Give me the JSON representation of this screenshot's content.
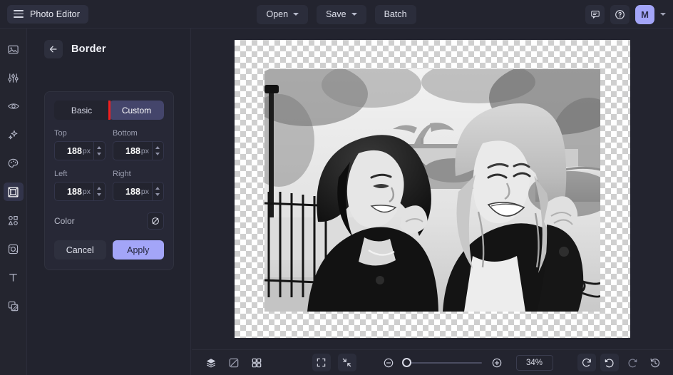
{
  "app": {
    "brand_title": "Photo Editor",
    "menu_icon": "hamburger-icon"
  },
  "topbar": {
    "open_label": "Open",
    "save_label": "Save",
    "batch_label": "Batch",
    "feedback_icon": "comment-icon",
    "help_icon": "question-circle-icon",
    "avatar_initial": "M",
    "avatar_color": "#a3a5f8"
  },
  "rail": {
    "items": [
      {
        "name": "image-icon",
        "label": "Image",
        "active": false
      },
      {
        "name": "adjustments-icon",
        "label": "Adjust",
        "active": false
      },
      {
        "name": "eye-icon",
        "label": "Retouch",
        "active": false
      },
      {
        "name": "sparkles-icon",
        "label": "Effects",
        "active": false
      },
      {
        "name": "palette-icon",
        "label": "Filters",
        "active": false
      },
      {
        "name": "border-icon",
        "label": "Border",
        "active": true
      },
      {
        "name": "shapes-icon",
        "label": "Shapes",
        "active": false
      },
      {
        "name": "frame-icon",
        "label": "Frames",
        "active": false
      },
      {
        "name": "text-icon",
        "label": "Text",
        "active": false
      },
      {
        "name": "layers-overlay-icon",
        "label": "Overlay",
        "active": false
      }
    ]
  },
  "panel": {
    "back_icon": "arrow-left-icon",
    "title": "Border",
    "tabs": [
      {
        "label": "Basic",
        "active": false
      },
      {
        "label": "Custom",
        "active": true
      }
    ],
    "highlight_color": "#f01f1f",
    "fields": [
      {
        "label": "Top",
        "value": "188",
        "unit": "px"
      },
      {
        "label": "Bottom",
        "value": "188",
        "unit": "px"
      },
      {
        "label": "Left",
        "value": "188",
        "unit": "px"
      },
      {
        "label": "Right",
        "value": "188",
        "unit": "px"
      }
    ],
    "color_label": "Color",
    "color_swatch_icon": "no-color-slashed-circle-icon",
    "cancel_label": "Cancel",
    "apply_label": "Apply"
  },
  "canvas": {
    "background": "transparent-checkerboard",
    "photo_alt": "Black and white photo of two women laughing outdoors in a park"
  },
  "bottombar": {
    "left_tools": [
      {
        "name": "layers-icon"
      },
      {
        "name": "transparency-icon"
      },
      {
        "name": "grid-icon"
      }
    ],
    "fit_tools": [
      {
        "name": "fit-screen-icon"
      },
      {
        "name": "shrink-to-fit-icon"
      }
    ],
    "zoom_out_icon": "zoom-out-icon",
    "zoom_in_icon": "zoom-in-icon",
    "zoom_value": "34%",
    "zoom_percent": 34,
    "right_tools": [
      {
        "name": "reset-icon",
        "enabled": true
      },
      {
        "name": "undo-icon",
        "enabled": true
      },
      {
        "name": "redo-icon",
        "enabled": false
      },
      {
        "name": "history-icon",
        "enabled": true
      }
    ]
  }
}
